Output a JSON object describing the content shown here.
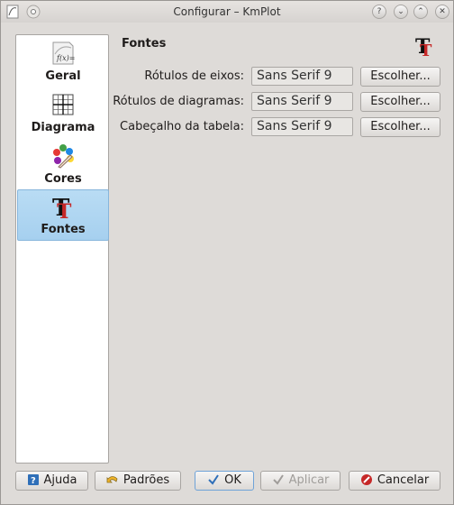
{
  "window": {
    "title": "Configurar – KmPlot"
  },
  "titlebar_buttons": {
    "help": "?",
    "minimize": "⌄",
    "maximize": "⌃",
    "close": "✕"
  },
  "sidebar": {
    "items": [
      {
        "label": "Geral",
        "icon": "function-icon",
        "selected": false
      },
      {
        "label": "Diagrama",
        "icon": "grid-icon",
        "selected": false
      },
      {
        "label": "Cores",
        "icon": "palette-icon",
        "selected": false
      },
      {
        "label": "Fontes",
        "icon": "font-icon",
        "selected": true
      }
    ]
  },
  "page": {
    "heading": "Fontes",
    "rows": [
      {
        "label": "Rótulos de eixos:",
        "value": "Sans Serif 9",
        "button": "Escolher..."
      },
      {
        "label": "Rótulos de diagramas:",
        "value": "Sans Serif 9",
        "button": "Escolher..."
      },
      {
        "label": "Cabeçalho da tabela:",
        "value": "Sans Serif 9",
        "button": "Escolher..."
      }
    ]
  },
  "footer": {
    "help": "Ajuda",
    "defaults": "Padrões",
    "ok": "OK",
    "apply": "Aplicar",
    "cancel": "Cancelar"
  },
  "colors": {
    "selection": "#a6d0ef",
    "background": "#dedbd8",
    "cancel_red": "#c62828"
  }
}
